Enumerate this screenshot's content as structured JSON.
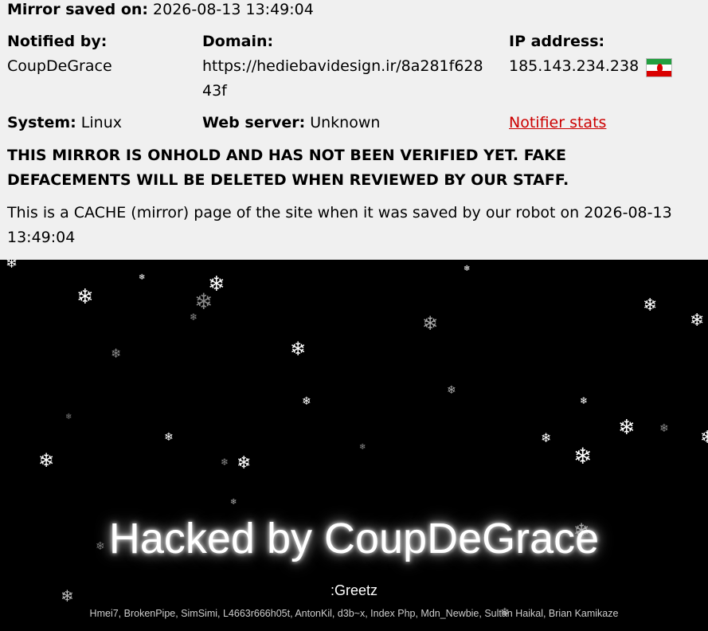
{
  "header": {
    "mirror_saved_label": "Mirror saved on:",
    "mirror_saved_value": "2026-08-13 13:49:04",
    "notified_by_label": "Notified by:",
    "notified_by_value": "CoupDeGrace",
    "domain_label": "Domain:",
    "domain_line1": "https://hediebavidesign.ir/8a281f628",
    "domain_line2": "43f",
    "ip_label": "IP address:",
    "ip_value": "185.143.234.238",
    "flag_icon": "iran-flag-icon",
    "system_label": "System:",
    "system_value": "Linux",
    "webserver_label": "Web server:",
    "webserver_value": "Unknown",
    "notifier_stats_link": "Notifier stats",
    "warning_line1": "THIS MIRROR IS ONHOLD AND HAS NOT BEEN VERIFIED YET. FAKE",
    "warning_line2": "DEFACEMENTS WILL BE DELETED WHEN REVIEWED BY OUR STAFF.",
    "cache_line1": "This is a CACHE (mirror) page of the site when it was saved by our robot on 2026-08-13",
    "cache_line2": "13:49:04"
  },
  "deface": {
    "title": "Hacked by CoupDeGrace",
    "greetz_heading": ":Greetz",
    "greetz_names": "Hmei7, BrokenPipe, SimSimi, L4663r666h05t, AntonKil, d3b~x, Index Php, Mdn_Newbie, Sultan Haikal, Brian Kamikaze"
  },
  "colors": {
    "header_bg": "#f0f0f0",
    "link_red": "#cc0000",
    "page_bg": "#000000",
    "flag_green": "#239f40",
    "flag_red": "#da0000"
  }
}
